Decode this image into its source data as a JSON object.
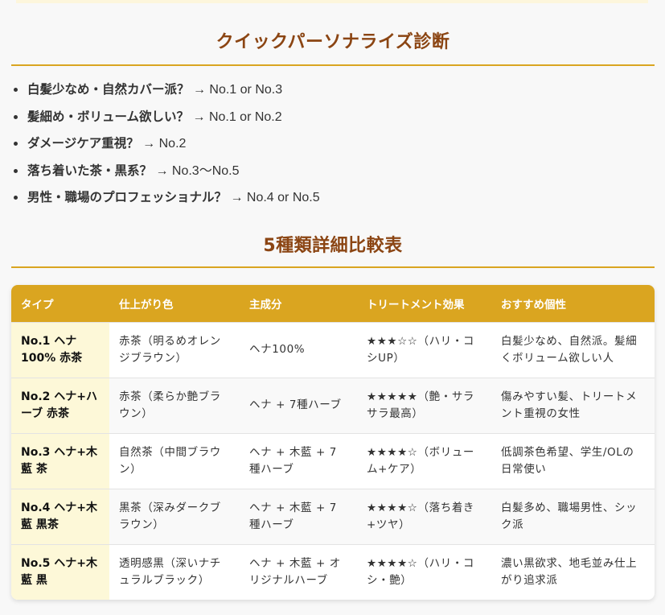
{
  "quick": {
    "title": "クイックパーソナライズ診断",
    "items": [
      {
        "question": "白髪少なめ・自然カバー派？",
        "answer": " → No.1 or No.3"
      },
      {
        "question": "髪細め・ボリューム欲しい？",
        "answer": " → No.1 or No.2"
      },
      {
        "question": "ダメージケア重視？",
        "answer": " → No.2"
      },
      {
        "question": "落ち着いた茶・黒系？",
        "answer": " → No.3〜No.5"
      },
      {
        "question": "男性・職場のプロフェッショナル？",
        "answer": " → No.4 or No.5"
      }
    ]
  },
  "compare": {
    "title": "5種類詳細比較表",
    "headers": [
      "タイプ",
      "仕上がり色",
      "主成分",
      "トリートメント効果",
      "おすすめ個性"
    ],
    "rows": [
      [
        "No.1 ヘナ100% 赤茶",
        "赤茶（明るめオレンジブラウン）",
        "ヘナ100%",
        "★★★☆☆（ハリ・コシUP）",
        "白髪少なめ、自然派。髪細くボリューム欲しい人"
      ],
      [
        "No.2 ヘナ+ハーブ 赤茶",
        "赤茶（柔らか艶ブラウン）",
        "ヘナ + 7種ハーブ",
        "★★★★★（艶・サラサラ最高）",
        "傷みやすい髪、トリートメント重視の女性"
      ],
      [
        "No.3 ヘナ+木藍 茶",
        "自然茶（中間ブラウン）",
        "ヘナ + 木藍 + 7種ハーブ",
        "★★★★☆（ボリューム+ケア）",
        "低調茶色希望、学生/OLの日常使い"
      ],
      [
        "No.4 ヘナ+木藍 黒茶",
        "黒茶（深みダークブラウン）",
        "ヘナ + 木藍 + 7種ハーブ",
        "★★★★☆（落ち着き+ツヤ）",
        "白髪多め、職場男性、シック派"
      ],
      [
        "No.5 ヘナ+木藍 黒",
        "透明感黒（深いナチュラルブラック）",
        "ヘナ + 木藍 + オリジナルハーブ",
        "★★★★☆（ハリ・コシ・艶）",
        "濃い黒欲求、地毛並み仕上がり追求派"
      ]
    ]
  },
  "colors": {
    "accent": "#daa520",
    "title": "#8b4513",
    "type_cell_bg": "#fdf8d8"
  }
}
